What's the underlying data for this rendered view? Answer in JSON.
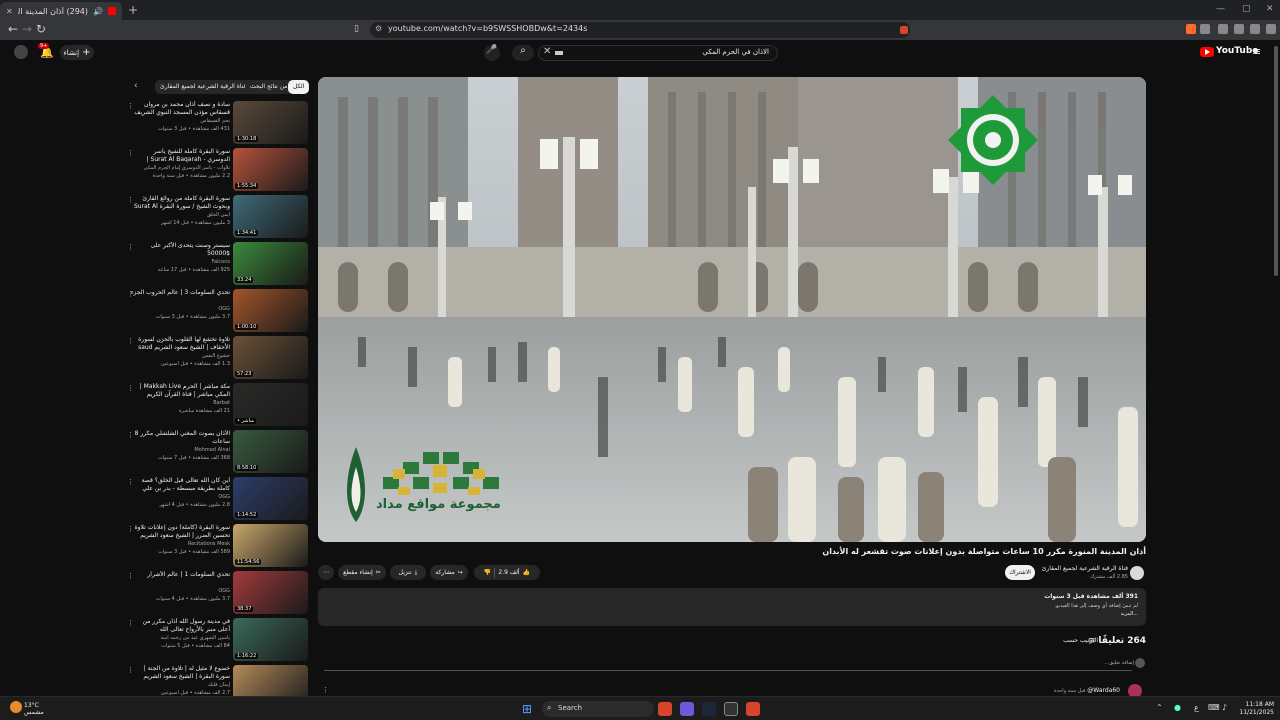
{
  "browser": {
    "tab_title": "(294) أذان المدينة المنورة مكرر",
    "url": "youtube.com/watch?v=b9SWSSHOBDw&t=2434s"
  },
  "header": {
    "search_query": "الاذان في الحرم المكي",
    "create_label": "إنشاء",
    "notif_badge": "9+",
    "logo_text": "YouTube"
  },
  "sidebar": {
    "chips": [
      "الكل",
      "من نتائج البحث",
      "من قناة الرقية الشرعية لجميع المقارئ"
    ],
    "items": [
      {
        "title": "سادة و نصف أذان محمد بن مروان قسقاس مؤذن المسجد النبوي الشريف",
        "channel": "نجم القسقاس",
        "meta": "431 ألف مشاهدة • قبل 3 سنوات",
        "duration": "1:30:18"
      },
      {
        "title": "سورة البقرة كاملة للشيخ ياسر الدوسري - Surat Al Baqarah | طاردة الشياطين",
        "channel": "تلاوات - ياسر الدوسري إمام الحرم المكي",
        "meta": "2.2 مليون مشاهدة • قبل سنة واحدة",
        "duration": "1:55:34"
      },
      {
        "title": "سورة البقرة كاملة من روائع القارئ وبحوث الشيخ / سورة البقرة Surat Al",
        "channel": "أيمن الحلق",
        "meta": "3 مليون مشاهدة • قبل 14 أشهر",
        "duration": "1:34:41"
      },
      {
        "title": "سيستر وسنت يتحدى الأكبر على $50000",
        "channel": "Falcons",
        "meta": "925 ألف مشاهدة • قبل 17 ساعة",
        "duration": "33:24"
      },
      {
        "title": "تحدي السلومات 3 | عالم الحروب الجزء",
        "channel": "OGG",
        "meta": "3.7 مليون مشاهدة • قبل 3 سنوات",
        "duration": "1:00:10"
      },
      {
        "title": "تلاوة تخشع لها القلوب بالحزن لسورة الأحقاف | الشيخ سعود الشريم saud",
        "channel": "خشوع النفس",
        "meta": "1.3 ألف مشاهدة • قبل أسبوعين",
        "duration": "57:23"
      },
      {
        "title": "مكة مباشر | الحرم Makkah Live | المكي مباشر | قناة القرآن الكريم السعودية",
        "channel": "Barbat",
        "meta": "21 ألف مشاهدة مباشرة",
        "duration": "• مباشر"
      },
      {
        "title": "الأذان بصوت المغني الشلشلي مكرر 8 ساعات",
        "channel": "Mohmad Alnai",
        "meta": "368 ألف مشاهدة • قبل 7 سنوات",
        "duration": "8:58:10"
      },
      {
        "title": "أين كان الله تعالى قبل الخلق؟ قصة كاملة بطريقة مبسطة - بدر بن علي",
        "channel": "OGG",
        "meta": "2.8 مليون مشاهدة • قبل 4 أشهر",
        "duration": "1:14:52"
      },
      {
        "title": "سورة البقرة (كاملة) دون إعلانات تلاوة تحسين الضرر | الشيخ سعود الشريم surah",
        "channel": "Recitations Mesk",
        "meta": "589 ألف مشاهدة • قبل 3 سنوات",
        "duration": "11:54:56"
      },
      {
        "title": "تحدي السلومات 1 | عالم الأشرار",
        "channel": "OGG",
        "meta": "3.7 مليون مشاهدة • قبل 4 سنوات",
        "duration": "38:37"
      },
      {
        "title": "في مدينة رسول الله أذان مكرر من أعلى منبر بالأرواح تعالى الله",
        "channel": "ياسين الشهري عيد من رحمه آمنة",
        "meta": "84 ألف مشاهدة • قبل 5 سنوات",
        "duration": "1:16:22"
      },
      {
        "title": "خضوع لا مثيل له | تلاوة من الجنة | سورة البقرة | الشيخ سعود الشريم saud",
        "channel": "إيمان قلبك",
        "meta": "2.7 ألف مشاهدة • قبل أسبوعين",
        "duration": ""
      }
    ]
  },
  "player": {
    "logo_text": "مجموعة مواقع مداد"
  },
  "video": {
    "title": "أذان المدينة المنورة مكرر 10 ساعات متواصلة بدون إعلانات صوت تقشعر له الأبدان",
    "channel": "قناة الرقية الشرعية لجميع المقارئ",
    "subs": "2.85 ألف مشترك",
    "subscribe_label": "الاشتراك",
    "likes": "2.9 ألف",
    "share_label": "مشاركة",
    "download_label": "تنزيل",
    "clip_label": "إنشاء مقطع"
  },
  "description": {
    "stats": "391 ألف مشاهدة قبل 3 سنوات",
    "line1": "لم تنسَ إضافة أي وصف إلى هذا الفيديو.",
    "more": "...المزيد"
  },
  "comments": {
    "count": "264 تعليقًا",
    "sort_label": "الترتيب حسب",
    "add_placeholder": "إضافة تعليق...",
    "first_author": "Warda60@",
    "first_time": "قبل سنة واحدة"
  },
  "taskbar": {
    "search_label": "Search",
    "weather_temp": "13°C",
    "weather_desc": "مشمس",
    "time": "11:18 AM",
    "date": "11/21/2025",
    "lang": "ع"
  },
  "colors": {
    "bg": "#0f0f0f",
    "youtube_red": "#ff0000",
    "chip_bg": "#272727"
  }
}
